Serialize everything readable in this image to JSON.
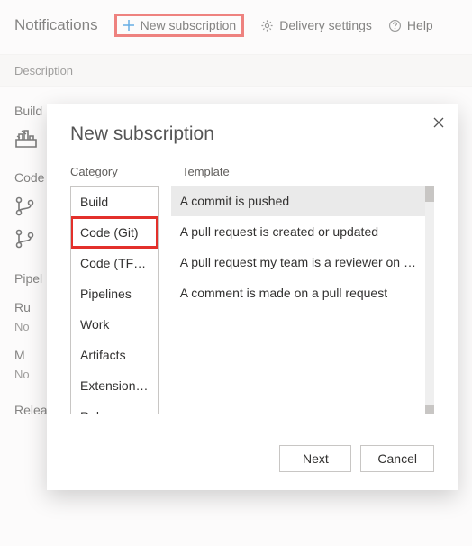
{
  "header": {
    "title": "Notifications",
    "new_subscription": "New subscription",
    "delivery_settings": "Delivery settings",
    "help": "Help"
  },
  "desc_label": "Description",
  "bg": {
    "section1": "Build",
    "section2": "Code",
    "section3": "Pipel",
    "row_r": "Ru",
    "row_n": "No",
    "row_m": "M",
    "row_n2": "No",
    "section4": "Release"
  },
  "modal": {
    "title": "New subscription",
    "category_label": "Category",
    "template_label": "Template",
    "categories": [
      "Build",
      "Code (Git)",
      "Code (TFVC)",
      "Pipelines",
      "Work",
      "Artifacts",
      "Extension …",
      "Release"
    ],
    "selected_category_index": 1,
    "templates": [
      "A commit is pushed",
      "A pull request is created or updated",
      "A pull request my team is a reviewer on …",
      "A comment is made on a pull request"
    ],
    "selected_template_index": 0,
    "next": "Next",
    "cancel": "Cancel"
  }
}
